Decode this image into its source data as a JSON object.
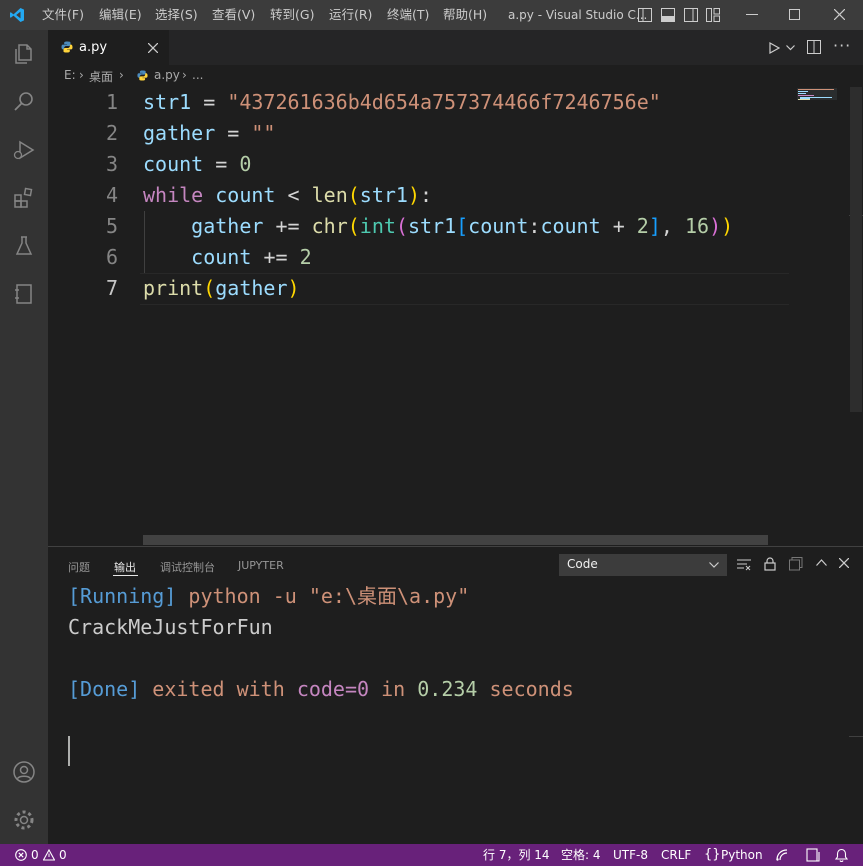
{
  "titlebar": {
    "menus": [
      "文件(F)",
      "编辑(E)",
      "选择(S)",
      "查看(V)",
      "转到(G)",
      "运行(R)",
      "终端(T)",
      "帮助(H)"
    ],
    "title": "a.py - Visual Studio C...",
    "accent": "#007acc"
  },
  "tab": {
    "label": "a.py"
  },
  "breadcrumbs": {
    "drive": "E:",
    "folder": "桌面",
    "file": "a.py",
    "more": "..."
  },
  "editor": {
    "line_numbers": [
      "1",
      "2",
      "3",
      "4",
      "5",
      "6",
      "7"
    ],
    "current_line": "7"
  },
  "panel": {
    "tabs": [
      "问题",
      "输出",
      "调试控制台",
      "JUPYTER"
    ],
    "active_tab": "输出",
    "channel": "Code",
    "output": {
      "line1_tag": "[Running]",
      "line1_cmd": "python -u \"e:\\桌面\\a.py\"",
      "line2": "CrackMeJustForFun",
      "line4_tag": "[Done]",
      "line4_w1": "exited",
      "line4_w2": "with",
      "line4_w3": "code=0",
      "line4_w4": "in",
      "line4_w5": "0.234",
      "line4_w6": "seconds"
    }
  },
  "status": {
    "errors": "0",
    "warnings": "0",
    "position": "行 7，列 14",
    "spaces": "空格: 4",
    "encoding": "UTF-8",
    "eol": "CRLF",
    "language": "Python",
    "bg": "#68217a"
  }
}
